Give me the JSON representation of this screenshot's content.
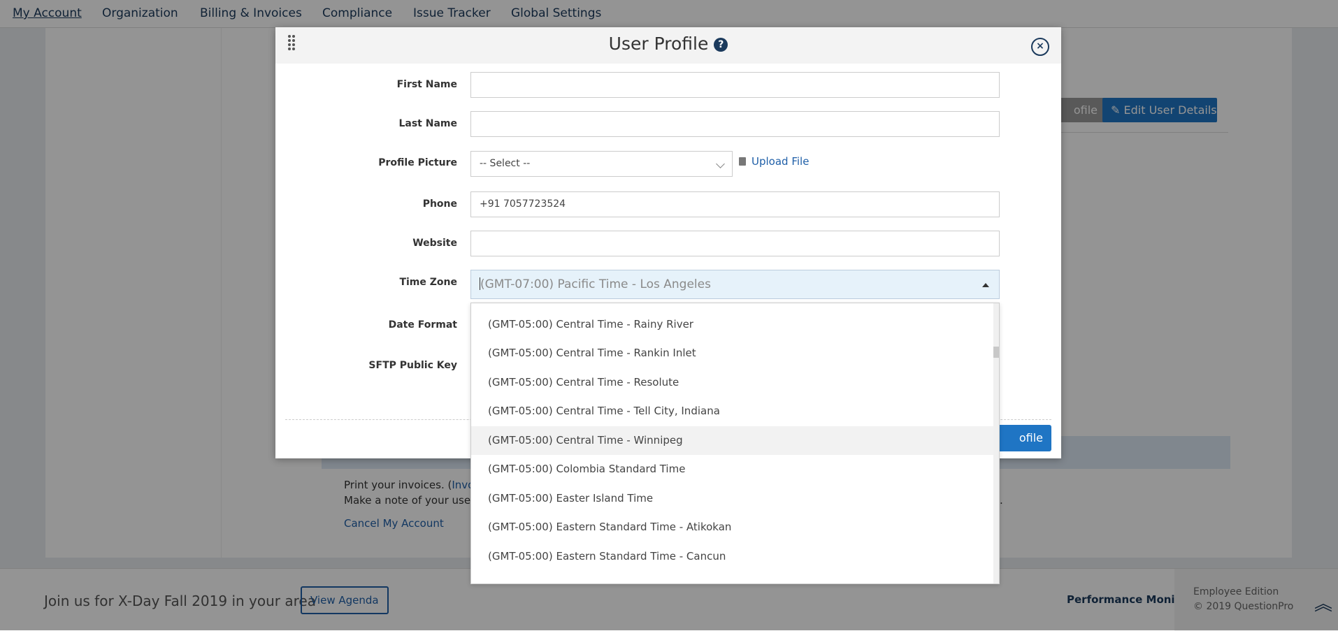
{
  "topnav": {
    "items": [
      {
        "label": "My Account",
        "active": true
      },
      {
        "label": "Organization"
      },
      {
        "label": "Billing & Invoices"
      },
      {
        "label": "Compliance"
      },
      {
        "label": "Issue Tracker"
      },
      {
        "label": "Global Settings"
      }
    ]
  },
  "background": {
    "grey_button_label": "ofile",
    "edit_button_label": "Edit User Details",
    "print_text": "Print your invoices. (",
    "print_link": "Invoic",
    "note_text": "Make a note of your userna",
    "note_tail": "cts.",
    "cancel_link": "Cancel My Account"
  },
  "footer": {
    "join_text": "Join us for X-Day Fall 2019 in your area",
    "agenda_button": "View Agenda",
    "perf_link": "Performance Monitor",
    "edition": "Employee Edition",
    "copyright": "© 2019 QuestionPro"
  },
  "modal": {
    "title": "User Profile",
    "help_glyph": "?",
    "close_glyph": "×",
    "fields": {
      "first_name": {
        "label": "First Name",
        "value": ""
      },
      "last_name": {
        "label": "Last Name",
        "value": ""
      },
      "profile_picture": {
        "label": "Profile Picture",
        "value": "-- Select --"
      },
      "phone": {
        "label": "Phone",
        "value": "+91 7057723524"
      },
      "website": {
        "label": "Website",
        "value": ""
      },
      "time_zone": {
        "label": "Time Zone",
        "value": "(GMT-07:00) Pacific Time - Los Angeles"
      },
      "date_format": {
        "label": "Date Format"
      },
      "sftp": {
        "label": "SFTP Public Key"
      }
    },
    "upload_label": "Upload File",
    "update_button": "ofile"
  },
  "dropdown": {
    "items": [
      "(GMT-05:00) Central Time - Rainy River",
      "(GMT-05:00) Central Time - Rankin Inlet",
      "(GMT-05:00) Central Time - Resolute",
      "(GMT-05:00) Central Time - Tell City, Indiana",
      "(GMT-05:00) Central Time - Winnipeg",
      "(GMT-05:00) Colombia Standard Time",
      "(GMT-05:00) Easter Island Time",
      "(GMT-05:00) Eastern Standard Time - Atikokan",
      "(GMT-05:00) Eastern Standard Time - Cancun"
    ],
    "highlighted_index": 4
  }
}
